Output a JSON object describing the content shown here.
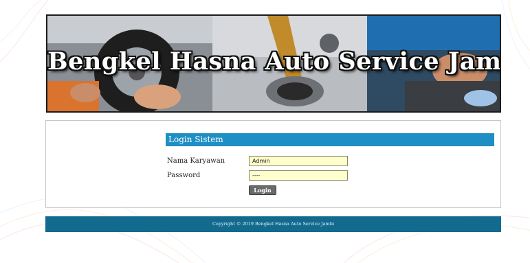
{
  "banner": {
    "title": "Bengkel Hasna Auto Service Jambi"
  },
  "login": {
    "header": "Login Sistem",
    "name_label": "Nama Karyawan",
    "name_value": "Admin",
    "password_label": "Password",
    "password_value": "----",
    "button_label": "Login"
  },
  "footer": {
    "copyright": "Copyright © 2019 Bengkel Hasna Auto Service Jambi"
  },
  "colors": {
    "header_bar": "#1e8fc4",
    "footer_bar": "#126b8e",
    "input_bg": "#fffecd"
  }
}
